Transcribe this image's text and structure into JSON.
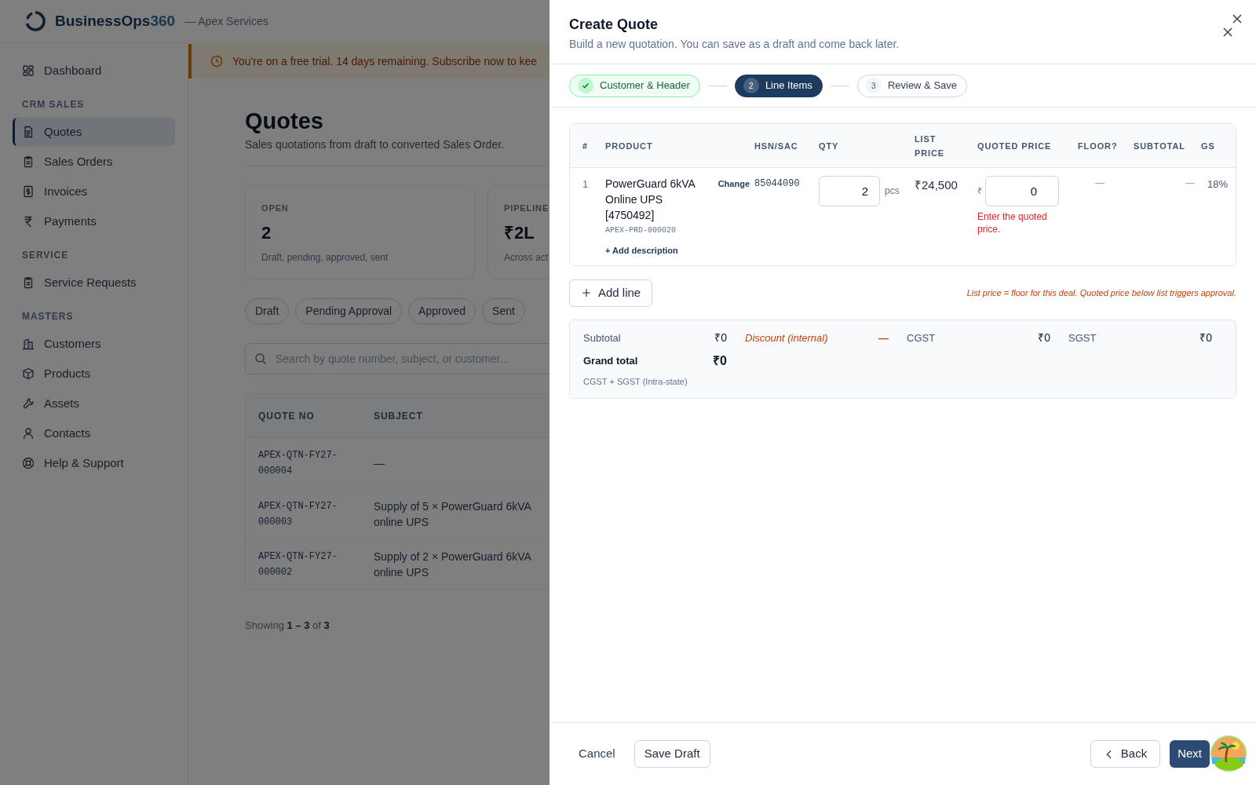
{
  "app": {
    "brand": "BusinessOps",
    "brand_number": "360",
    "org": "— Apex Services"
  },
  "sidebar": {
    "sections": [
      {
        "items": [
          {
            "label": "Dashboard",
            "selected": false
          }
        ]
      },
      {
        "title": "CRM SALES",
        "items": [
          {
            "label": "Quotes",
            "selected": true
          },
          {
            "label": "Sales Orders",
            "selected": false
          },
          {
            "label": "Invoices",
            "selected": false
          },
          {
            "label": "Payments",
            "selected": false
          }
        ]
      },
      {
        "title": "SERVICE",
        "items": [
          {
            "label": "Service Requests",
            "selected": false
          }
        ]
      },
      {
        "title": "MASTERS",
        "items": [
          {
            "label": "Customers",
            "selected": false
          },
          {
            "label": "Products",
            "selected": false
          },
          {
            "label": "Assets",
            "selected": false
          },
          {
            "label": "Contacts",
            "selected": false
          },
          {
            "label": "Help & Support",
            "selected": false
          }
        ]
      }
    ]
  },
  "banner": {
    "text": "You're on a free trial. 14 days remaining. Subscribe now to kee"
  },
  "page": {
    "title": "Quotes",
    "subtitle": "Sales quotations from draft to converted Sales Order."
  },
  "stats": [
    {
      "label": "OPEN",
      "value": "2",
      "note": "Draft, pending, approved, sent"
    },
    {
      "label": "PIPELINE",
      "value": "₹2L",
      "note": "Across act"
    }
  ],
  "filters": [
    {
      "label": "Draft",
      "selected": false
    },
    {
      "label": "Pending Approval",
      "selected": false
    },
    {
      "label": "Approved",
      "selected": false
    },
    {
      "label": "Sent",
      "selected": false
    }
  ],
  "search": {
    "placeholder": "Search by quote number, subject, or customer..."
  },
  "quotes_table": {
    "columns": [
      "QUOTE NO",
      "SUBJECT"
    ],
    "rows": [
      {
        "quote_no": "APEX-QTN-FY27-000004",
        "subject": "—"
      },
      {
        "quote_no": "APEX-QTN-FY27-000003",
        "subject": "Supply of 5 × PowerGuard 6kVA online UPS"
      },
      {
        "quote_no": "APEX-QTN-FY27-000002",
        "subject": "Supply of 2 × PowerGuard 6kVA online UPS"
      }
    ]
  },
  "pagination": "Showing **1 – 3** of **3**",
  "drawer": {
    "title": "Create Quote",
    "subtitle": "Build a new quotation. You can save as a draft and come back later.",
    "steps": [
      {
        "label": "Customer & Header",
        "completed": true,
        "selected": false
      },
      {
        "number": "2",
        "label": "Line Items",
        "completed": false,
        "selected": true
      },
      {
        "number": "3",
        "label": "Review & Save",
        "completed": false,
        "selected": false
      }
    ],
    "line_items": {
      "columns": [
        "#",
        "PRODUCT",
        "HSN/SAC",
        "QTY",
        "LIST PRICE",
        "QUOTED PRICE",
        "FLOOR?",
        "SUBTOTAL",
        "GS"
      ],
      "rows": [
        {
          "index": "1",
          "product": "PowerGuard 6kVA Online UPS [4750492]",
          "change": "Change",
          "code": "APEX-PRD-000020",
          "add_description": "+ Add description",
          "hsn": "85044090",
          "qty": "2",
          "unit": "pcs",
          "list_price": "₹24,500",
          "currency": "₹",
          "quoted_price": "0",
          "error": "Enter the quoted price.",
          "floor": "—",
          "subtotal": "—",
          "gst": "18%"
        }
      ]
    },
    "add_line": "Add line",
    "note": "List price = floor for this deal. Quoted price below list triggers approval.",
    "totals": {
      "subtotal_label": "Subtotal",
      "subtotal": "₹0",
      "discount_label": "Discount (internal)",
      "discount": "—",
      "cgst_label": "CGST",
      "cgst": "₹0",
      "sgst_label": "SGST",
      "sgst": "₹0",
      "grand_total_label": "Grand total",
      "grand_total": "₹0",
      "tax_note": "CGST + SGST (Intra-state)"
    },
    "footer": {
      "cancel": "Cancel",
      "save_draft": "Save Draft",
      "back": "Back",
      "next": "Next"
    }
  }
}
